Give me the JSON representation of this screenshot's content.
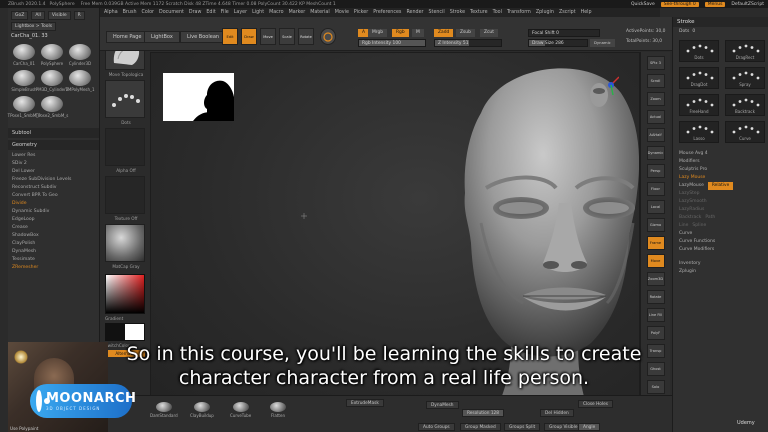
{
  "titlebar": {
    "app": "ZBrush 2020.1.4",
    "doc": "PolySphere",
    "stats": "Free Mem 0.039GB  Active Mem 1172  Scratch Disk 48  ZTime 4.648  Timer 0.08  PolyCount 30.422 KP  MeshCount 1",
    "quicksave": "QuickSave",
    "seethrough": "See-through 0",
    "menus": "Menus",
    "script": "DefaultZScript"
  },
  "menubar": [
    "Alpha",
    "Brush",
    "Color",
    "Document",
    "Draw",
    "Edit",
    "File",
    "Layer",
    "Light",
    "Macro",
    "Marker",
    "Material",
    "Movie",
    "Picker",
    "Preferences",
    "Render",
    "Stencil",
    "Stroke",
    "Texture",
    "Tool",
    "Transform",
    "Zplugin",
    "Zscript",
    "Help"
  ],
  "leftpanel": {
    "top_buttons": [
      "GoZ",
      "All",
      "Visible",
      "R"
    ],
    "lightbox_tools": "Lightbox > Tools",
    "tool_name": "CarCha_01. 33",
    "tools": [
      {
        "label": "CarCha_01",
        "icon": "head-icon"
      },
      {
        "label": "PolySphere",
        "icon": "sphere-icon"
      },
      {
        "label": "Cylinder3D",
        "icon": "cylinder-icon"
      },
      {
        "label": "SimpleBrush",
        "icon": "brush-icon"
      },
      {
        "label": "PM3D_Cylinder3",
        "icon": "cylinder-icon"
      },
      {
        "label": "TMPolyMesh_1",
        "icon": "star-icon"
      },
      {
        "label": "TPose1_SmbM_s",
        "icon": "figure-icon"
      },
      {
        "label": "TPose2_SmbM_s",
        "icon": "figure-icon"
      }
    ],
    "subtool_header": "Subtool",
    "geometry_header": "Geometry",
    "geometry_items": [
      "Lower Res",
      "SDiv 2",
      "Del Lower",
      "Freeze SubDivision Levels",
      "Reconstruct Subdiv",
      "Convert BPR To Geo",
      "Divide",
      "Dynamic Subdiv",
      "EdgeLoop",
      "Crease",
      "ShadowBox",
      "ClayPolish",
      "DynaMesh",
      "Tessimate",
      "ZRemesher"
    ],
    "higher_res": "Higher Res",
    "smt": "Smt",
    "suv": "Suv",
    "reuv": "ReUV"
  },
  "matcol": {
    "brush_label": "Move Topologica",
    "stroke_label": "Dots",
    "alpha_label": "Alpha Off",
    "texture_label": "Texture Off",
    "material_label": "MatCap Gray",
    "gradient_label": "Gradient",
    "switch_label": "SwitchColor",
    "alternate_label": "Alternate"
  },
  "topbar": {
    "home_page": "Home Page",
    "lightbox": "LightBox",
    "live_boolean": "Live Boolean",
    "modes": [
      {
        "label": "Edit",
        "active": true
      },
      {
        "label": "Draw",
        "active": true
      },
      {
        "label": "Move",
        "active": false
      },
      {
        "label": "Scale",
        "active": false
      },
      {
        "label": "Rotate",
        "active": false
      }
    ],
    "a_chip": "A",
    "mrgb": "Mrgb",
    "rgb": "Rgb",
    "m": "M",
    "zadd": "Zadd",
    "zsub": "Zsub",
    "zcut": "Zcut",
    "rgb_intensity": "Rgb Intensity 100",
    "z_intensity": "Z Intensity 51",
    "focal_shift": "Focal Shift 0",
    "draw_size": "Draw Size 286",
    "dynamic": "Dynamic",
    "active_points": "ActivePoints: 30,0",
    "total_points": "TotalPoints: 30,0"
  },
  "canvas": {
    "reference_alt": "silhouette reference",
    "model_alt": "sculpted head"
  },
  "rshelf": [
    "SPix 3",
    "Scroll",
    "Zoom",
    "Actual",
    "AAHalf",
    "Dynamic",
    "Persp",
    "Floor",
    "Local",
    "Gizmo",
    "Frame",
    "Move",
    "Zoom3D",
    "Rotate",
    "Line Fill",
    "PolyF",
    "Transp",
    "Ghost",
    "Solo",
    "Xpose"
  ],
  "rpanel": {
    "title": "Stroke",
    "dots_label": "Dots",
    "dots_value": "0",
    "strokes": [
      "Dots",
      "DragRect",
      "DragDot",
      "Spray",
      "FreeHand",
      "Backtrack",
      "Lasso",
      "Curve"
    ],
    "mouse_avg": "Mouse Avg 4",
    "modifiers": "Modifiers",
    "sculptris_pro": "Sculptris Pro",
    "lazy_mouse_header": "Lazy Mouse",
    "lazy_mouse": "LazyMouse",
    "relative": "Relative",
    "lazy_step": "LazyStep",
    "lazy_smooth": "LazySmooth",
    "lazy_radius": "LazyRadius",
    "backtrack": "Backtrack",
    "path_line": "Line",
    "spline": "Spline",
    "path": "Path",
    "curve": "Curve",
    "curve_functions": "Curve Functions",
    "curve_modifiers": "Curve Modifiers",
    "inventory": "Inventory",
    "zplugin": "Zplugin"
  },
  "bottombar": {
    "brushes": [
      "DamStandard",
      "ClayBuildup",
      "CurveTube",
      "Flatten"
    ],
    "extrude_mask": "ExtrudeMask",
    "dynamesh": "DynaMesh",
    "resolution": "Resolution 128",
    "del_hidden": "Del Hidden",
    "close_holes": "Close Holes",
    "auto_groups": "Auto Groups",
    "group_masked": "Group Masked",
    "groups_split": "Groups Split",
    "group_visible": "Group Visible",
    "angle": "Angle",
    "use_polypaint": "Use Polypaint"
  },
  "overlay": {
    "logo_main": "MOONARCH",
    "logo_sub": "3D OBJECT DESIGN",
    "subtitle_line1": "So in this course, you'll be learning the skills to create",
    "subtitle_line2": "character character from a real life person.",
    "udemy": "Udemy"
  },
  "colors": {
    "accent": "#e08a1f",
    "panel": "#303030",
    "canvas": "#2f2f2f",
    "logo_blue": "#2a8be0"
  }
}
